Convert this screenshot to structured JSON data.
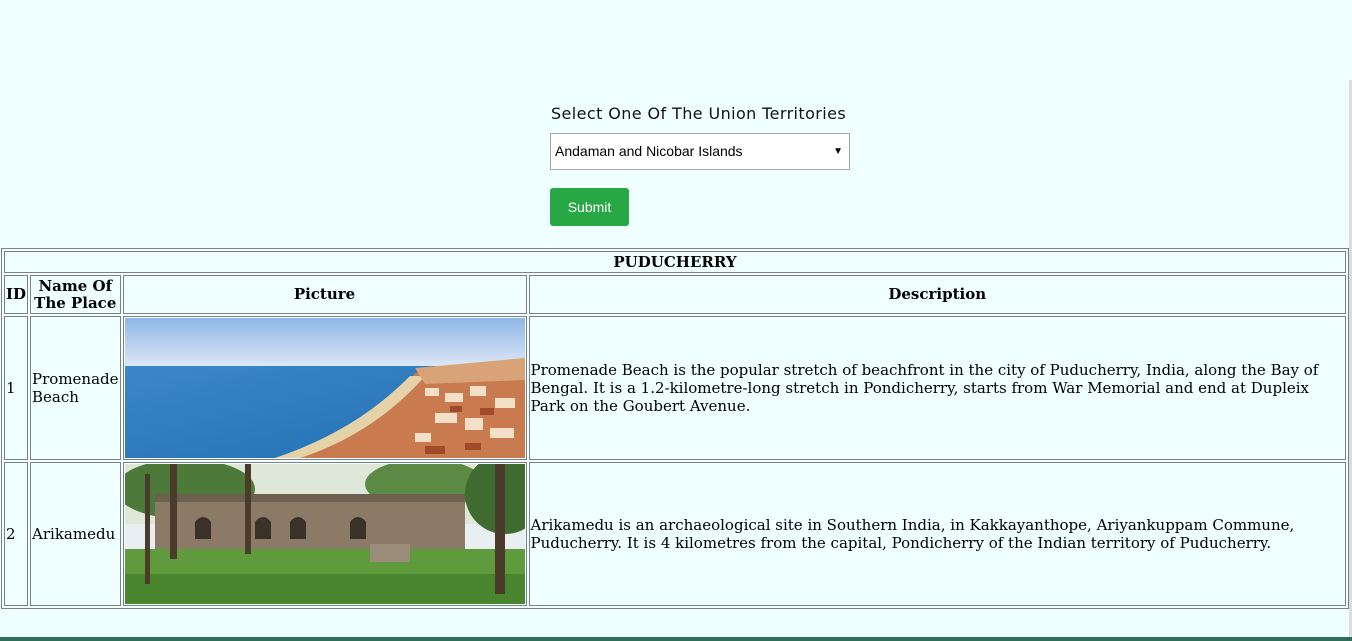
{
  "form": {
    "title": "Select One Of The Union Territories",
    "select_value": "Andaman and Nicobar Islands",
    "submit_label": "Submit"
  },
  "table": {
    "caption": "PUDUCHERRY",
    "headers": {
      "id": "ID",
      "name": "Name Of The Place",
      "picture": "Picture",
      "description": "Description"
    },
    "rows": [
      {
        "id": "1",
        "name": "Promenade Beach",
        "picture": "beach-photo",
        "description": "Promenade Beach is the popular stretch of beachfront in the city of Puducherry, India, along the Bay of Bengal. It is a 1.2-kilometre-long stretch in Pondicherry, starts from War Memorial and end at Dupleix Park on the Goubert Avenue."
      },
      {
        "id": "2",
        "name": "Arikamedu",
        "picture": "ruins-photo",
        "description": "Arikamedu is an archaeological site in Southern India, in Kakkayanthope, Ariyankuppam Commune, Puducherry. It is 4 kilometres from the capital, Pondicherry of the Indian territory of Puducherry."
      }
    ]
  },
  "colors": {
    "background": "#f0ffff",
    "submit": "#28a745",
    "border": "#808080"
  }
}
